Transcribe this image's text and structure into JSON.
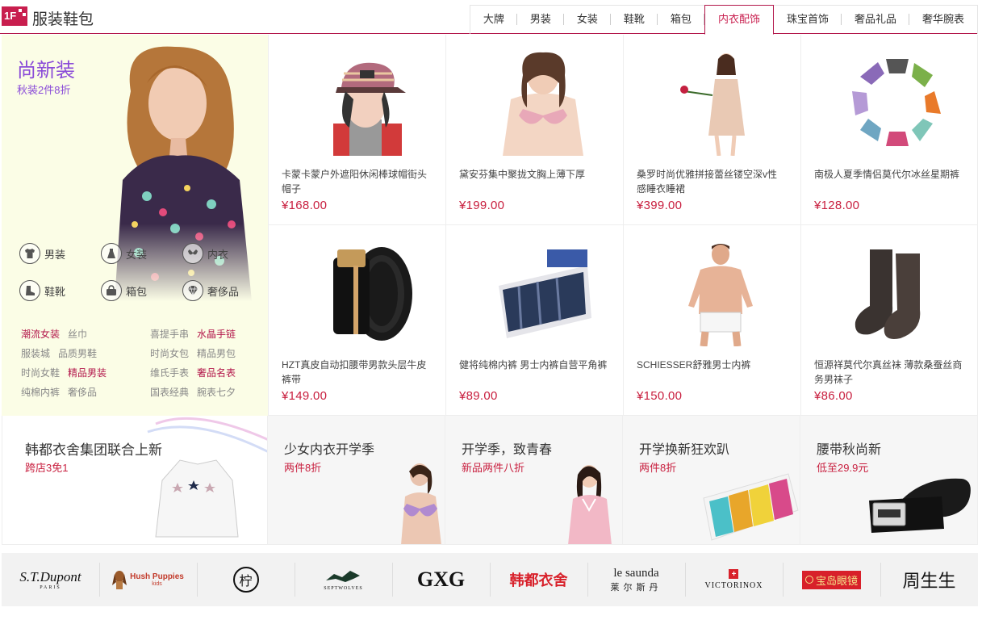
{
  "header": {
    "floor": "1F",
    "title": "服装鞋包",
    "tabs": [
      "大牌",
      "男装",
      "女装",
      "鞋靴",
      "箱包",
      "内衣配饰",
      "珠宝首饰",
      "奢品礼品",
      "奢华腕表"
    ],
    "active_tab": "内衣配饰"
  },
  "left_panel": {
    "title": "尚新装",
    "subtitle": "秋装2件8折",
    "categories": [
      "男装",
      "女装",
      "内衣",
      "鞋靴",
      "箱包",
      "奢侈品"
    ],
    "links": [
      {
        "text": "潮流女装",
        "hot": true
      },
      {
        "text": "丝巾",
        "hot": false
      },
      {
        "text": "喜提手串",
        "hot": false
      },
      {
        "text": "水晶手链",
        "hot": true
      },
      {
        "text": "服装城",
        "hot": false
      },
      {
        "text": "品质男鞋",
        "hot": false
      },
      {
        "text": "时尚女包",
        "hot": false
      },
      {
        "text": "精品男包",
        "hot": false
      },
      {
        "text": "时尚女鞋",
        "hot": false
      },
      {
        "text": "精品男装",
        "hot": true
      },
      {
        "text": "维氏手表",
        "hot": false
      },
      {
        "text": "奢品名表",
        "hot": true
      },
      {
        "text": "纯棉内裤",
        "hot": false
      },
      {
        "text": "奢侈品",
        "hot": false
      },
      {
        "text": "国表经典",
        "hot": false
      },
      {
        "text": "腕表七夕",
        "hot": false
      }
    ]
  },
  "products": [
    {
      "name": "卡蒙卡蒙户外遮阳休闲棒球帽街头帽子",
      "price": "¥168.00",
      "icon": "cap-model-image"
    },
    {
      "name": "黛安芬集中聚拢文胸上薄下厚",
      "price": "¥199.00",
      "icon": "bra-model-image"
    },
    {
      "name": "桑罗时尚优雅拼接蕾丝镂空深v性感睡衣睡裙",
      "price": "¥399.00",
      "icon": "nightgown-model-image"
    },
    {
      "name": "南极人夏季情侣莫代尔冰丝星期裤",
      "price": "¥128.00",
      "icon": "underwear-ring-image"
    },
    {
      "name": "HZT真皮自动扣腰带男款头层牛皮裤带",
      "price": "¥149.00",
      "icon": "belt-image"
    },
    {
      "name": "健将纯棉内裤 男士内裤自营平角裤",
      "price": "¥89.00",
      "icon": "boxer-box-image"
    },
    {
      "name": "SCHIESSER舒雅男士内裤",
      "price": "¥150.00",
      "icon": "male-model-image"
    },
    {
      "name": "恒源祥莫代尔真丝袜 薄款桑蚕丝商务男袜子",
      "price": "¥86.00",
      "icon": "socks-image"
    }
  ],
  "promos": [
    {
      "title": "韩都衣舍集团联合上新",
      "sub": "跨店3免1"
    },
    {
      "title": "少女内衣开学季",
      "sub": "两件8折"
    },
    {
      "title": "开学季，致青春",
      "sub": "新品两件八折"
    },
    {
      "title": "开学换新狂欢趴",
      "sub": "两件8折"
    },
    {
      "title": "腰带秋尚新",
      "sub": "低至29.9元"
    }
  ],
  "brands": [
    {
      "name": "S.T.Dupont",
      "sub": "PARIS"
    },
    {
      "name": "Hush Puppies",
      "sub": "kids"
    },
    {
      "name": "柠",
      "sub": ""
    },
    {
      "name": "SEPTWOLVES",
      "sub": ""
    },
    {
      "name": "GXG",
      "sub": ""
    },
    {
      "name": "韩都衣舍",
      "sub": ""
    },
    {
      "name": "le saunda",
      "sub": "莱尔斯丹"
    },
    {
      "name": "VICTORINOX",
      "sub": ""
    },
    {
      "name": "宝岛眼镜",
      "sub": ""
    },
    {
      "name": "周生生",
      "sub": ""
    }
  ],
  "colors": {
    "brand": "#c81e4e",
    "price": "#c81e3e",
    "accent_purple": "#8a4bd8"
  }
}
